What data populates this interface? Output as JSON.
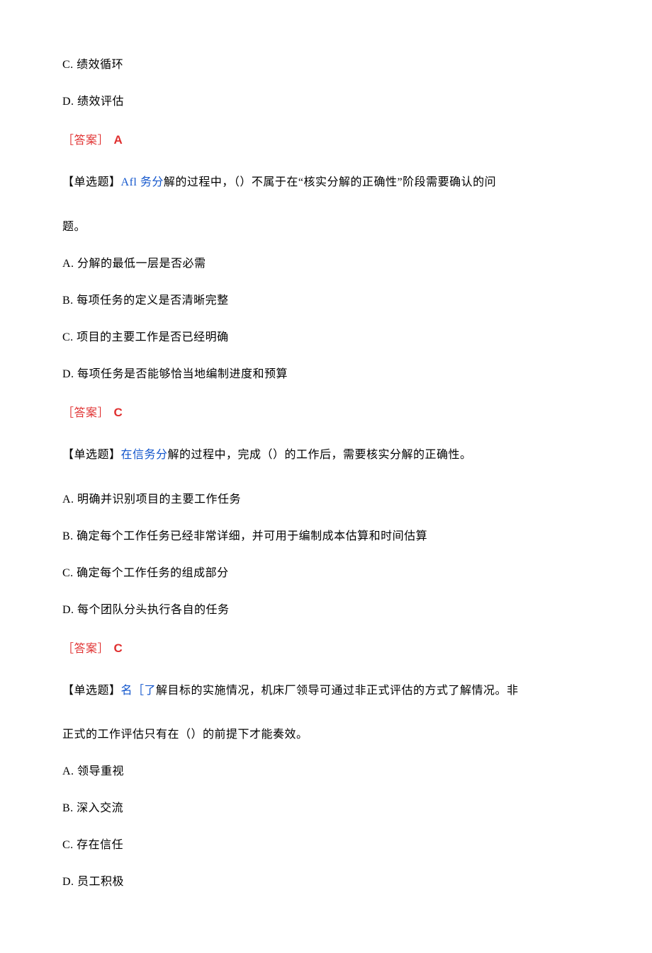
{
  "prev_question_tail": {
    "opt_c": "C. 绩效循环",
    "opt_d": "D. 绩效评估",
    "answer_label": "［答案］",
    "answer_value": "A"
  },
  "q1": {
    "prefix": "【单选题】",
    "blue": "Afl 务分",
    "stem_rest": "解的过程中，（）不属于在“核实分解的正确性”阶段需要确认的问",
    "stem_cont": "题。",
    "opt_a": "A. 分解的最低一层是否必需",
    "opt_b": "B. 每项任务的定义是否清晰完整",
    "opt_c": "C. 项目的主要工作是否已经明确",
    "opt_d": "D. 每项任务是否能够恰当地编制进度和预算",
    "answer_label": "［答案］",
    "answer_value": "C"
  },
  "q2": {
    "prefix": "【单选题】",
    "blue": "在信务分",
    "stem_rest": "解的过程中，完成（）的工作后，需要核实分解的正确性。",
    "opt_a": "A. 明确并识别项目的主要工作任务",
    "opt_b": "B. 确定每个工作任务已经非常详细，并可用于编制成本估算和时间估算",
    "opt_c": "C. 确定每个工作任务的组成部分",
    "opt_d": "D. 每个团队分头执行各自的任务",
    "answer_label": "［答案］",
    "answer_value": "C"
  },
  "q3": {
    "prefix": "【单选题】",
    "blue": "名［了",
    "stem_rest": "解目标的实施情况，机床厂领导可通过非正式评估的方式了解情况。非",
    "stem_cont": "正式的工作评估只有在（）的前提下才能奏效。",
    "opt_a": "A. 领导重视",
    "opt_b": "B. 深入交流",
    "opt_c": "C. 存在信任",
    "opt_d": "D. 员工积极"
  }
}
